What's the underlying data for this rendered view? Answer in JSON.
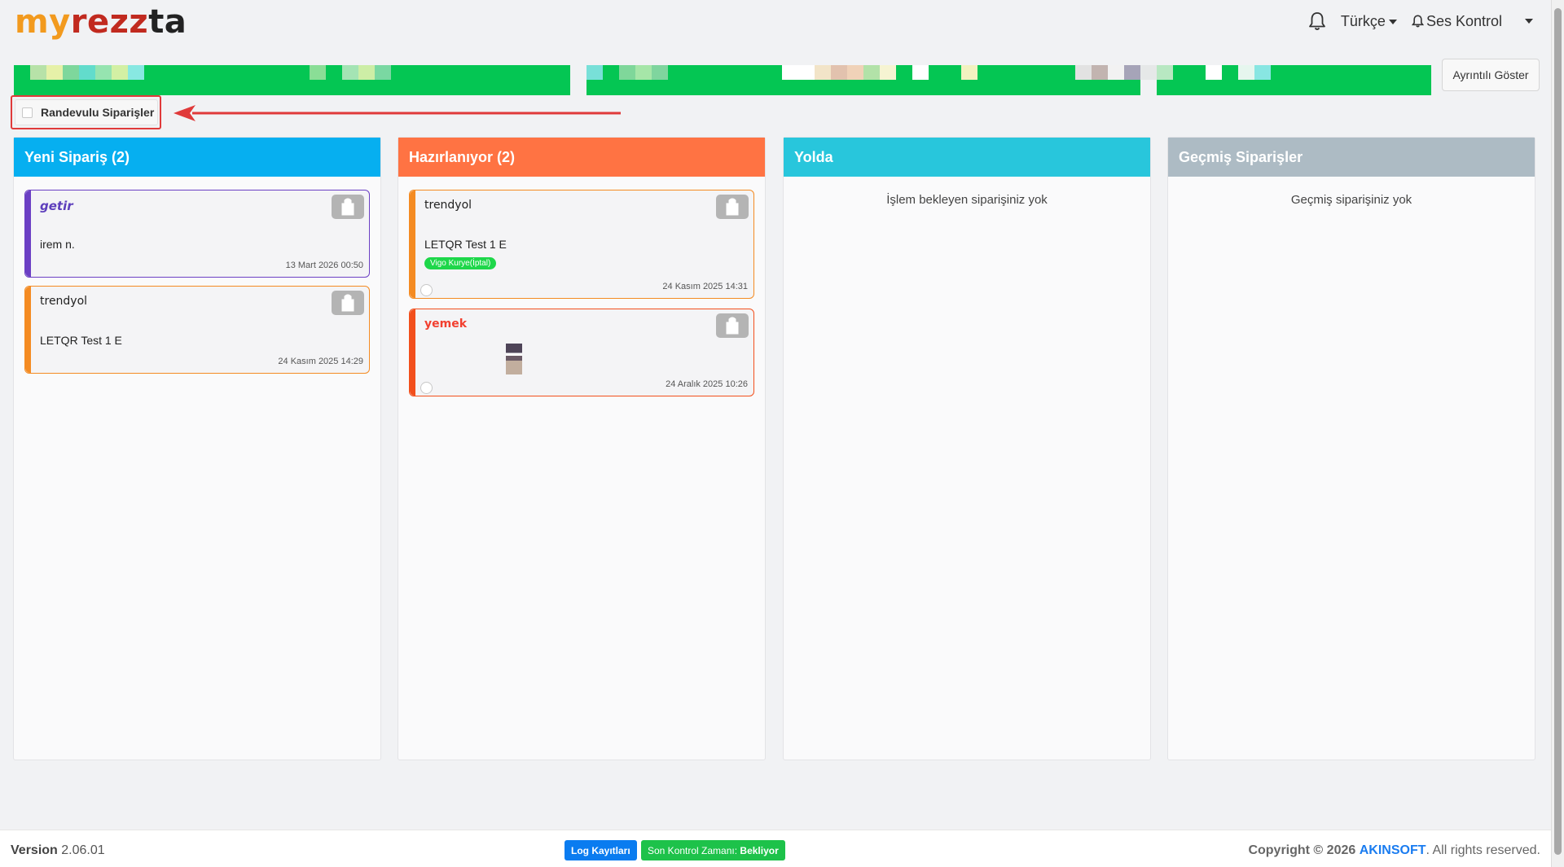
{
  "header": {
    "logo_part1": "my",
    "logo_part2": "rezz",
    "logo_part3": "ta",
    "language": "Türkçe",
    "sound_control": "Ses Kontrol",
    "detail_button": "Ayrıntılı Göster"
  },
  "filter": {
    "appointment_orders_label": "Randevulu Siparişler",
    "checked": false
  },
  "columns": [
    {
      "title": "Yeni Sipariş (2)",
      "color": "#06aff0",
      "cards": [
        {
          "brand": "getir",
          "customer": "irem n.",
          "time": "13 Mart 2026 00:50",
          "accent": "#6b3fc4"
        },
        {
          "brand": "trendyol",
          "customer": "LETQR Test 1 E",
          "time": "24 Kasım 2025 14:29",
          "accent": "#f48b22"
        }
      ]
    },
    {
      "title": "Hazırlanıyor (2)",
      "color": "#ff7343",
      "cards": [
        {
          "brand": "trendyol",
          "customer": "LETQR Test 1 E",
          "badge": "Vigo Kurye(İptal)",
          "time": "24 Kasım 2025 14:31",
          "accent": "#f48b22"
        },
        {
          "brand": "yemek",
          "customer": "",
          "time": "24 Aralık 2025 10:26",
          "accent": "#f24f1c"
        }
      ]
    },
    {
      "title": "Yolda",
      "color": "#28c6dc",
      "empty_message": "İşlem bekleyen siparişiniz yok"
    },
    {
      "title": "Geçmiş Siparişler",
      "color": "#adbbc4",
      "empty_message": "Geçmiş siparişiniz yok"
    }
  ],
  "footer": {
    "version_label": "Version",
    "version_number": "2.06.01",
    "log_button": "Log Kayıtları",
    "control_label": "Son Kontrol Zamanı:",
    "control_value": "Bekliyor",
    "copyright_prefix": "Copyright © 2026",
    "company": "AKINSOFT",
    "rights": ". All rights reserved."
  },
  "icons": {
    "bell": "bell-icon",
    "bag": "shopping-bag-icon",
    "arrow": "red-pointer-arrow"
  }
}
